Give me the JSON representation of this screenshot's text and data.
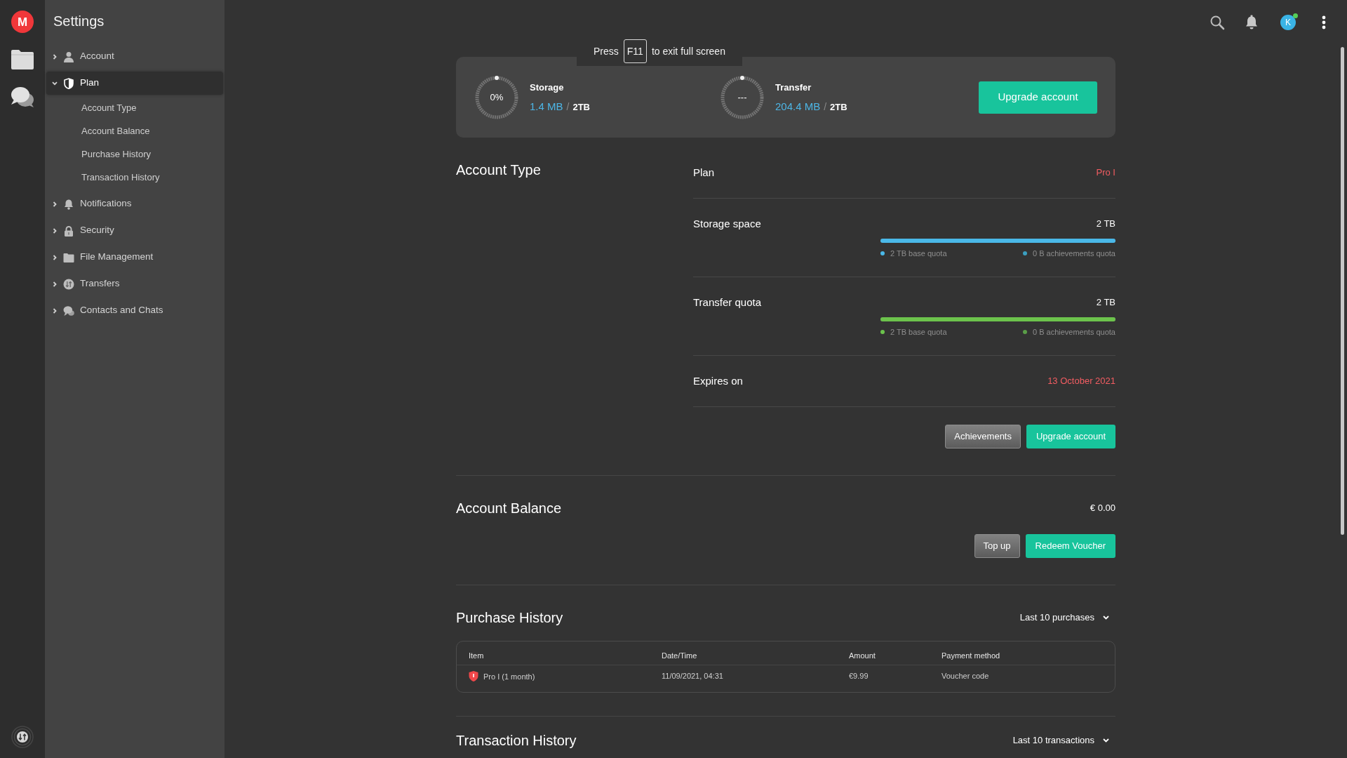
{
  "app_logo": {
    "letter": "M"
  },
  "sidebar": {
    "title": "Settings",
    "items": [
      {
        "label": "Account",
        "expanded": false,
        "selected": false
      },
      {
        "label": "Plan",
        "expanded": true,
        "selected": true,
        "children": [
          {
            "label": "Account Type",
            "selected": false
          },
          {
            "label": "Account Balance",
            "selected": false
          },
          {
            "label": "Purchase History",
            "selected": false
          },
          {
            "label": "Transaction History",
            "selected": false
          }
        ]
      },
      {
        "label": "Notifications",
        "expanded": false,
        "selected": false
      },
      {
        "label": "Security",
        "expanded": false,
        "selected": false
      },
      {
        "label": "File Management",
        "expanded": false,
        "selected": false
      },
      {
        "label": "Transfers",
        "expanded": false,
        "selected": false
      },
      {
        "label": "Contacts and Chats",
        "expanded": false,
        "selected": false
      }
    ]
  },
  "top_bar": {
    "avatar": {
      "initial": "K",
      "online": true
    }
  },
  "fullscreen_notice": {
    "before": "Press",
    "key": "F11",
    "after": "to exit full screen"
  },
  "usage_card": {
    "meters": [
      {
        "ring_label": "0%",
        "title": "Storage",
        "used": "1.4 MB",
        "separator": "/",
        "total": "2TB"
      },
      {
        "ring_label": "---",
        "title": "Transfer",
        "used": "204.4 MB",
        "separator": "/",
        "total": "2TB"
      }
    ],
    "button": "Upgrade account"
  },
  "account_type": {
    "title": "Account Type",
    "rows": [
      {
        "kind": "value",
        "label": "Plan",
        "value": "Pro I"
      },
      {
        "kind": "quota",
        "label": "Storage space",
        "value": "2 TB",
        "level": 1,
        "color": "#4ab8e8",
        "legend": [
          {
            "text": "2 TB base quota",
            "color": "#4ab8e8"
          },
          {
            "text": "0 B achievements quota",
            "color": "#3b9fc0"
          }
        ]
      },
      {
        "kind": "quota",
        "label": "Transfer quota",
        "value": "2 TB",
        "level": 1,
        "color": "#6cc34c",
        "legend": [
          {
            "text": "2 TB base quota",
            "color": "#6cc34c"
          },
          {
            "text": "0 B achievements quota",
            "color": "#5a9e48"
          }
        ]
      },
      {
        "kind": "value",
        "label": "Expires on",
        "value": "13 October 2021"
      }
    ],
    "buttons": [
      {
        "label": "Achievements",
        "kind": "secondary"
      },
      {
        "label": "Upgrade account",
        "kind": "primary"
      }
    ]
  },
  "account_balance": {
    "title": "Account Balance",
    "balance": "€ 0.00",
    "buttons": [
      {
        "label": "Top up",
        "kind": "secondary"
      },
      {
        "label": "Redeem Voucher",
        "kind": "primary"
      }
    ]
  },
  "purchase_history": {
    "title": "Purchase History",
    "filter": "Last 10 purchases",
    "table": {
      "columns": [
        "Item",
        "Date/Time",
        "Amount",
        "Payment method"
      ],
      "rows": [
        {
          "cells": [
            "Pro I (1 month)",
            "11/09/2021, 04:31",
            "€9.99",
            "Voucher code"
          ]
        }
      ]
    }
  },
  "transaction_history": {
    "title": "Transaction History",
    "filter": "Last 10 transactions"
  }
}
